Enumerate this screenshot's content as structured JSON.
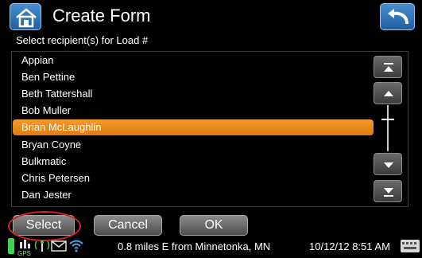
{
  "header": {
    "title": "Create Form",
    "home_icon": "home-icon",
    "back_icon": "back-arrow-icon"
  },
  "subtitle": "Select recipient(s) for  Load #",
  "recipients": [
    {
      "label": "Appian",
      "selected": false
    },
    {
      "label": "Ben Pettine",
      "selected": false
    },
    {
      "label": "Beth Tattershall",
      "selected": false
    },
    {
      "label": "Bob Muller",
      "selected": false
    },
    {
      "label": "Brian McLaughlin",
      "selected": true
    },
    {
      "label": "Bryan Coyne",
      "selected": false
    },
    {
      "label": "Bulkmatic",
      "selected": false
    },
    {
      "label": "Chris Petersen",
      "selected": false
    },
    {
      "label": "Dan Jester",
      "selected": false
    }
  ],
  "scroll": {
    "top_icon": "scroll-to-top-icon",
    "up_icon": "scroll-up-icon",
    "down_icon": "scroll-down-icon",
    "bottom_icon": "scroll-to-bottom-icon"
  },
  "buttons": {
    "select": "Select",
    "cancel": "Cancel",
    "ok": "OK"
  },
  "status": {
    "gps_label": "GPS",
    "location": "0.8 miles E from Minnetonka, MN",
    "datetime": "10/12/12 8:51 AM",
    "icons": [
      "battery-icon",
      "gps-icon",
      "signal-icon",
      "mail-icon",
      "wifi-icon",
      "keyboard-icon"
    ]
  },
  "colors": {
    "selection": "#f08a1c",
    "accent_blue": "#2f74ba",
    "highlight_ring": "#d0202a"
  }
}
